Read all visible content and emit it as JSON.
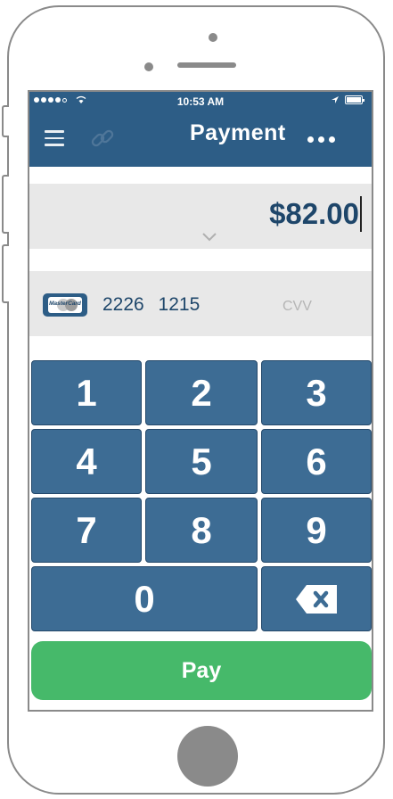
{
  "status_bar": {
    "time": "10:53 AM"
  },
  "nav": {
    "title": "Payment"
  },
  "amount": {
    "value": "$82.00"
  },
  "card": {
    "brand_label": "MasterCard",
    "number": "2226 1215",
    "cvv_placeholder": "CVV"
  },
  "keypad": {
    "keys": [
      "1",
      "2",
      "3",
      "4",
      "5",
      "6",
      "7",
      "8",
      "9",
      "0"
    ]
  },
  "pay_button": {
    "label": "Pay"
  },
  "colors": {
    "primary": "#2d5d86",
    "key": "#3d6c94",
    "pay": "#46b96a",
    "amount_text": "#1e466a"
  }
}
